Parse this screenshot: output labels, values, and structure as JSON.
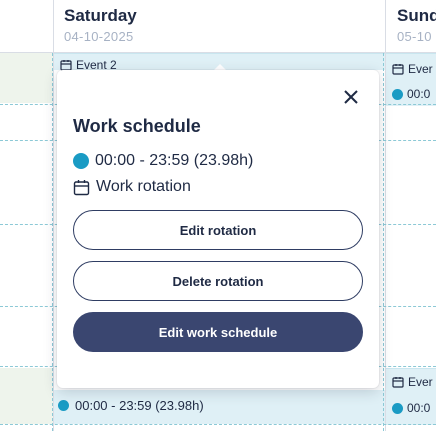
{
  "days": [
    {
      "name": "Saturday",
      "date": "04-10-2025"
    },
    {
      "name": "Sund",
      "date": "05-10"
    }
  ],
  "events": {
    "saturday_top": "Event 2",
    "sunday_top": "Ever",
    "sunday_shift_top": "00:0",
    "sunday_bottom": "Ever",
    "sunday_shift_bottom": "00:0",
    "saturday_shift": "00:00 - 23:59 (23.98h)"
  },
  "popover": {
    "title": "Work schedule",
    "time": "00:00 - 23:59 (23.98h)",
    "rotation": "Work rotation",
    "edit_rotation": "Edit rotation",
    "delete_rotation": "Delete rotation",
    "edit_schedule": "Edit work schedule"
  },
  "colors": {
    "accent_dot": "#1a9bc4",
    "primary_button": "#3a4670",
    "event_bg": "#dff0f6",
    "dashed": "#8cc9d6"
  },
  "icons": [
    "calendar-icon",
    "close-icon"
  ]
}
